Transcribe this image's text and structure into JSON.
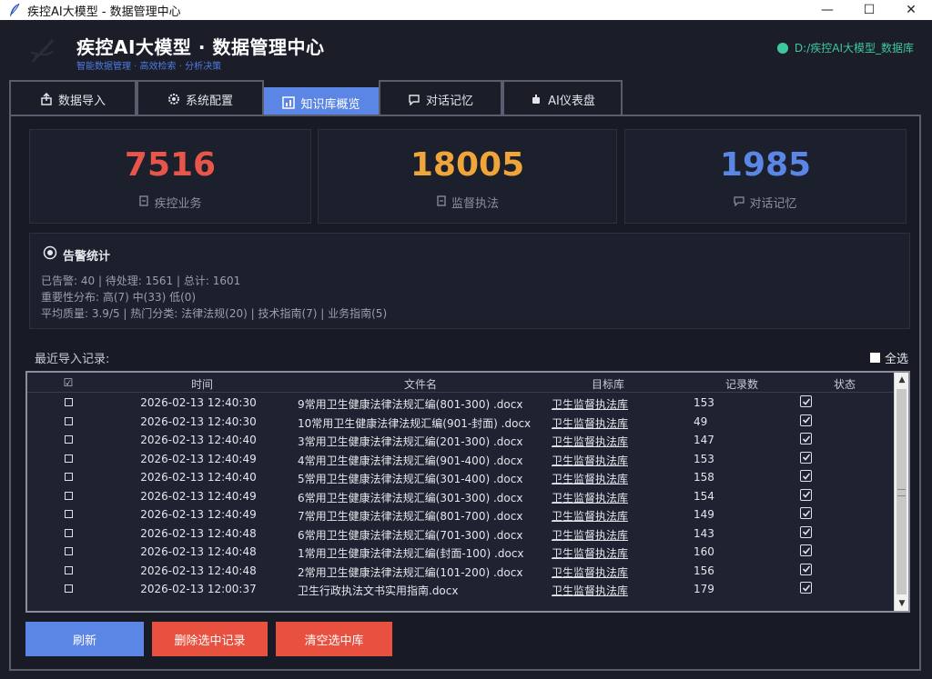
{
  "window": {
    "title": "疾控AI大模型 - 数据管理中心"
  },
  "header": {
    "title": "疾控AI大模型 · 数据管理中心",
    "subtitle": "智能数据管理 · 高效检索 · 分析决策",
    "path": "D:/疾控AI大模型_数据库"
  },
  "tabs": [
    {
      "label": "数据导入",
      "icon": "upload-icon",
      "active": false
    },
    {
      "label": "系统配置",
      "icon": "gear-icon",
      "active": false
    },
    {
      "label": "知识库概览",
      "icon": "chart-icon",
      "active": true
    },
    {
      "label": "对话记忆",
      "icon": "chat-icon",
      "active": false
    },
    {
      "label": "AI仪表盘",
      "icon": "robot-icon",
      "active": false
    }
  ],
  "stats": [
    {
      "value": "7516",
      "label": "疾控业务",
      "color": "#e8564a"
    },
    {
      "value": "18005",
      "label": "监督执法",
      "color": "#f0a53a"
    },
    {
      "value": "1985",
      "label": "对话记忆",
      "color": "#5b86e5"
    }
  ],
  "alarm": {
    "title": "告警统计",
    "line1": "已告警: 40  |  待处理: 1561  |  总计: 1601",
    "line2": "重要性分布: 高(7)  中(33)  低(0)",
    "line3": "平均质量: 3.9/5  |  热门分类: 法律法规(20) | 技术指南(7) | 业务指南(5)"
  },
  "recent": {
    "label": "最近导入记录:",
    "select_all": "全选"
  },
  "table": {
    "columns": [
      "☑",
      "时间",
      "文件名",
      "目标库",
      "记录数",
      "状态"
    ],
    "rows": [
      {
        "time": "2026-02-13 12:40:30",
        "file": "9常用卫生健康法律法规汇编(801-300) .docx",
        "target": "卫生监督执法库",
        "count": "153"
      },
      {
        "time": "2026-02-13 12:40:30",
        "file": "10常用卫生健康法律法规汇编(901-封面) .docx",
        "target": "卫生监督执法库",
        "count": "49"
      },
      {
        "time": "2026-02-13 12:40:40",
        "file": "3常用卫生健康法律法规汇编(201-300) .docx",
        "target": "卫生监督执法库",
        "count": "147"
      },
      {
        "time": "2026-02-13 12:40:49",
        "file": "4常用卫生健康法律法规汇编(901-400) .docx",
        "target": "卫生监督执法库",
        "count": "153"
      },
      {
        "time": "2026-02-13 12:40:40",
        "file": "5常用卫生健康法律法规汇编(301-400) .docx",
        "target": "卫生监督执法库",
        "count": "158"
      },
      {
        "time": "2026-02-13 12:40:49",
        "file": "6常用卫生健康法律法规汇编(301-300) .docx",
        "target": "卫生监督执法库",
        "count": "154"
      },
      {
        "time": "2026-02-13 12:40:49",
        "file": "7常用卫生健康法律法规汇编(801-700) .docx",
        "target": "卫生监督执法库",
        "count": "149"
      },
      {
        "time": "2026-02-13 12:40:48",
        "file": "6常用卫生健康法律法规汇编(701-300) .docx",
        "target": "卫生监督执法库",
        "count": "143"
      },
      {
        "time": "2026-02-13 12:40:48",
        "file": "1常用卫生健康法律法规汇编(封面-100) .docx",
        "target": "卫生监督执法库",
        "count": "160"
      },
      {
        "time": "2026-02-13 12:40:48",
        "file": "2常用卫生健康法律法规汇编(101-200) .docx",
        "target": "卫生监督执法库",
        "count": "156"
      },
      {
        "time": "2026-02-13 12:00:37",
        "file": "卫生行政执法文书实用指南.docx",
        "target": "卫生监督执法库",
        "count": "179"
      }
    ]
  },
  "buttons": {
    "refresh": "刷新",
    "delete_selected": "删除选中记录",
    "clear_selected_db": "清空选中库"
  }
}
